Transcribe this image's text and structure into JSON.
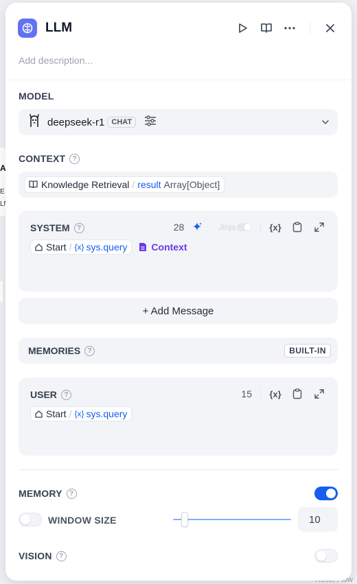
{
  "header": {
    "title": "LLM",
    "description_placeholder": "Add description..."
  },
  "model": {
    "section_label": "MODEL",
    "name": "deepseek-r1",
    "mode_badge": "CHAT"
  },
  "context": {
    "section_label": "CONTEXT",
    "source_node": "Knowledge Retrieval",
    "separator": "/",
    "variable": "result",
    "type": "Array[Object]"
  },
  "system": {
    "label": "SYSTEM",
    "token_count": "28",
    "jinja_label": "Jinja",
    "var_node": "Start",
    "separator": "/",
    "var_name": "sys.query",
    "context_label": "Context"
  },
  "add_message": {
    "label": "+ Add Message"
  },
  "memories": {
    "label": "MEMORIES",
    "badge": "BUILT-IN"
  },
  "user": {
    "label": "USER",
    "token_count": "15",
    "var_node": "Start",
    "separator": "/",
    "var_name": "sys.query"
  },
  "memory": {
    "label": "MEMORY",
    "enabled": true,
    "window_label": "WINDOW SIZE",
    "window_value": "10",
    "slider_fraction": 0.1
  },
  "vision": {
    "label": "VISION",
    "enabled": false
  },
  "background": {
    "reset_label": "Reset Flow",
    "frag1": "A",
    "frag2": "E",
    "frag3": "LM"
  },
  "icons": {
    "x_var": "{x}"
  },
  "colors": {
    "accent": "#155eef",
    "context_purple": "#6938ef",
    "app_icon": "#6172f3"
  }
}
